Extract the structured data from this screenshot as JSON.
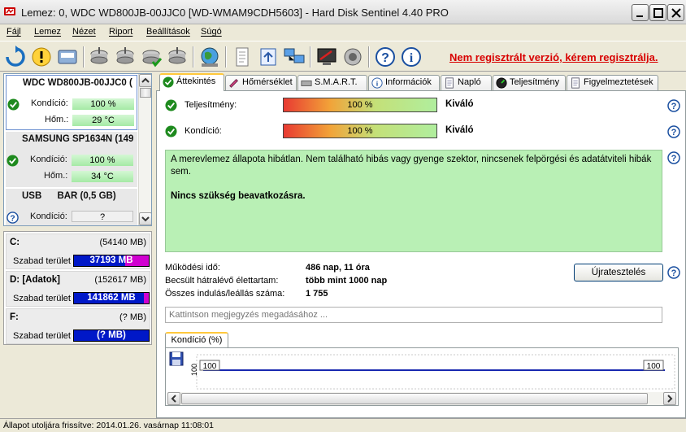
{
  "window": {
    "title": "Lemez: 0, WDC WD800JB-00JJC0 [WD-WMAM9CDH5603]  -  Hard Disk Sentinel 4.40 PRO"
  },
  "menu": [
    "Fájl",
    "Lemez",
    "Nézet",
    "Riport",
    "Beállítások",
    "Súgó"
  ],
  "toolbar": {
    "register_text": "Nem regisztrált verzió, kérem regisztrálja."
  },
  "disks": [
    {
      "title": "WDC WD800JB-00JJC0 (",
      "condition_label": "Kondíció:",
      "condition": "100 %",
      "temp_label": "Hőm.:",
      "temp": "29 °C"
    },
    {
      "title": "SAMSUNG SP1634N (149",
      "condition_label": "Kondíció:",
      "condition": "100 %",
      "temp_label": "Hőm.:",
      "temp": "34 °C"
    },
    {
      "title": "USB      BAR (0,5 GB)",
      "condition_label": "Kondíció:",
      "condition": "?"
    }
  ],
  "volumes": [
    {
      "name": "C:",
      "size": "(54140 MB)",
      "free_label": "Szabad terület",
      "free": "37193 MB",
      "used_fraction": 0.31,
      "color": "#d000d0"
    },
    {
      "name": "D: [Adatok]",
      "size": "(152617 MB)",
      "free_label": "Szabad terület",
      "free": "141862 MB",
      "used_fraction": 0.07,
      "color": "#d000d0"
    },
    {
      "name": "F:",
      "size": "(? MB)",
      "free_label": "Szabad terület",
      "free": "(? MB)",
      "used_fraction": 0.0,
      "color": "#0018c8"
    }
  ],
  "tabs": [
    "Áttekintés",
    "Hőmérséklet",
    "S.M.A.R.T.",
    "Információk",
    "Napló",
    "Teljesítmény",
    "Figyelmeztetések"
  ],
  "overview": {
    "performance_label": "Teljesítmény:",
    "performance_value": "100 %",
    "performance_rating": "Kiváló",
    "condition_label": "Kondíció:",
    "condition_value": "100 %",
    "condition_rating": "Kiváló",
    "status_text": "A merevlemez állapota hibátlan. Nem található hibás vagy gyenge szektor, nincsenek felpörgési és adatátviteli hibák sem.",
    "action_text": "Nincs szükség beavatkozásra.",
    "uptime_label": "Működési idő:",
    "uptime_value": "486 nap, 11 óra",
    "remaining_label": "Becsült hátralévő élettartam:",
    "remaining_value": "több mint 1000 nap",
    "startstop_label": "Összes indulás/leállás száma:",
    "startstop_value": "1 755",
    "retest_button": "Újratesztelés",
    "note_placeholder": "Kattintson megjegyzés megadásához ...",
    "graph_tab": "Kondíció  (%)",
    "graph_point_left": "100",
    "graph_point_right": "100",
    "graph_axis_label": "100"
  },
  "status": {
    "text": "Állapot utoljára frissítve: 2014.01.26. vasárnap 11:08:01"
  }
}
